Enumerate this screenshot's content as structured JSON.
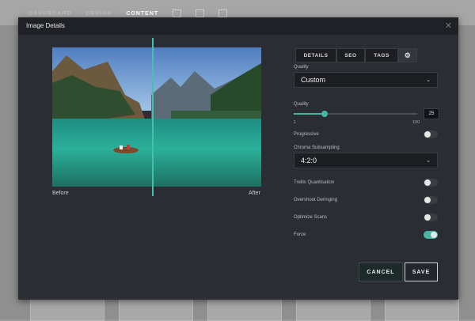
{
  "background_app": {
    "nav": [
      "DASHBOARD",
      "DESIGN",
      "CONTENT"
    ],
    "active_nav": "CONTENT"
  },
  "modal": {
    "title": "Image Details",
    "close_icon": "close-icon"
  },
  "preview": {
    "before_label": "Before",
    "after_label": "After"
  },
  "tabs": {
    "details": "DETAILS",
    "seo": "SEO",
    "tags": "TAGS",
    "settings_icon": "gear-icon"
  },
  "settings": {
    "quality_preset": {
      "label": "Quality",
      "value": "Custom"
    },
    "quality_slider": {
      "label": "Quality",
      "min": "1",
      "max": "100",
      "value": "25",
      "fraction": 0.25
    },
    "progressive": {
      "label": "Progressive",
      "on": false
    },
    "chroma_subsampling": {
      "label": "Chroma Subsampling",
      "value": "4:2:0"
    },
    "trellis": {
      "label": "Trellis Quantisation",
      "on": false
    },
    "overshoot": {
      "label": "Overshoot Deringing",
      "on": false
    },
    "optimize_scans": {
      "label": "Optimize Scans",
      "on": false
    },
    "force": {
      "label": "Force",
      "on": true
    }
  },
  "buttons": {
    "cancel": "CANCEL",
    "save": "SAVE"
  },
  "colors": {
    "accent": "#48b6a2",
    "modal_bg": "#2a2d33"
  }
}
